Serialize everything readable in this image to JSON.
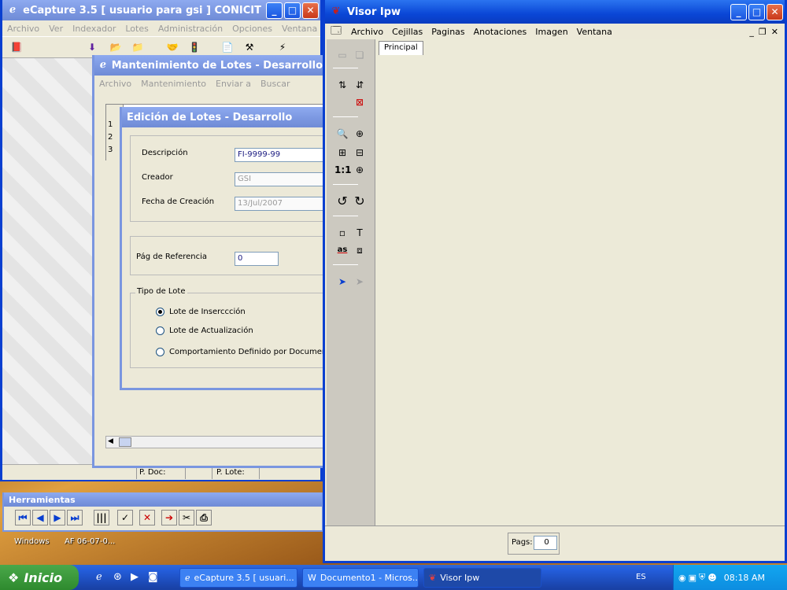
{
  "ecapture": {
    "title": "eCapture 3.5 [ usuario para gsi ] CONICIT",
    "menu": [
      "Archivo",
      "Ver",
      "Indexador",
      "Lotes",
      "Administración",
      "Opciones",
      "Ventana"
    ],
    "status": {
      "p_doc": "P. Doc:",
      "p_lote": "P. Lote:"
    }
  },
  "mantenimiento": {
    "title": "Mantenimiento de Lotes - Desarrollo",
    "menu": [
      "Archivo",
      "Mantenimiento",
      "Enviar a",
      "Buscar"
    ],
    "rows": [
      "1",
      "2",
      "3"
    ]
  },
  "edicion": {
    "title": "Edición de Lotes - Desarrollo",
    "descripcion_label": "Descripción",
    "descripcion_value": "FI-9999-99",
    "creador_label": "Creador",
    "creador_value": "GSI",
    "fecha_label": "Fecha de Creación",
    "fecha_value": "13/Jul/2007",
    "pag_ref_label": "Pág de Referencia",
    "pag_ref_value": "0",
    "tipo_label": "Tipo de Lote",
    "radios": [
      {
        "label": "Lote de Inserccción",
        "checked": true
      },
      {
        "label": "Lote de Actualización",
        "checked": false
      },
      {
        "label": "Comportamiento Definido por Documento",
        "checked": false
      }
    ]
  },
  "herramientas": {
    "title": "Herramientas"
  },
  "visor": {
    "title": "Visor Ipw",
    "menu": [
      "Archivo",
      "Cejillas",
      "Paginas",
      "Anotaciones",
      "Imagen",
      "Ventana"
    ],
    "tab": "Principal",
    "pags_label": "Pags:",
    "pags_value": "0",
    "zoom_label": "1:1",
    "annot_label": "as"
  },
  "desktop": {
    "label1": "Windows",
    "label2": "AF 06-07-0..."
  },
  "taskbar": {
    "start": "Inicio",
    "tasks": [
      "eCapture 3.5 [ usuari...",
      "Documento1 - Micros...",
      "Visor Ipw"
    ],
    "lang": "ES",
    "clock": "08:18 AM"
  },
  "colors": {
    "accent": "#0a46d6",
    "start": "#3a9a3a"
  }
}
